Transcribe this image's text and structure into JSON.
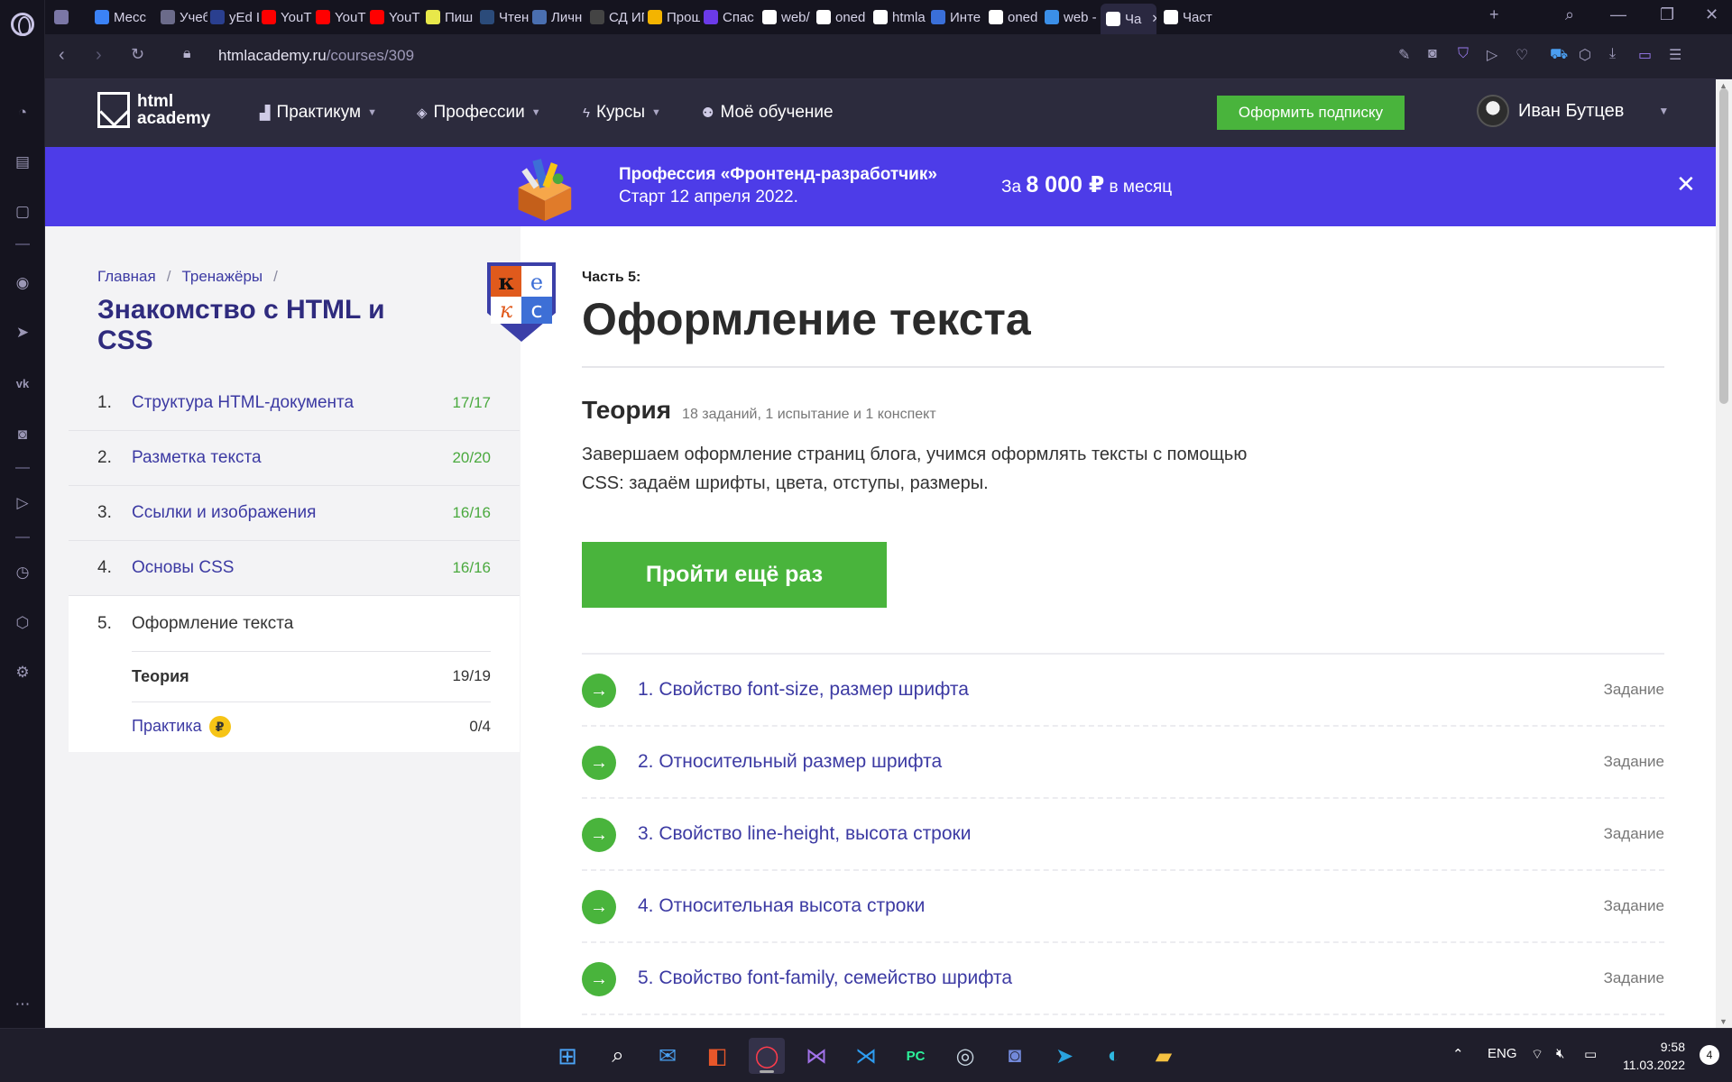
{
  "browser": {
    "tabs": [
      {
        "label": "",
        "favicon_color": "#7b77a6",
        "icon": "gamepad-icon"
      },
      {
        "label": "Месс",
        "favicon_color": "#3b82f6",
        "icon": "messenger-icon"
      },
      {
        "label": "Учеб",
        "favicon_color": "#6b6b8a",
        "icon": "mail-icon"
      },
      {
        "label": "yEd L",
        "favicon_color": "#2a3f8f",
        "icon": "yed-icon"
      },
      {
        "label": "YouT",
        "favicon_color": "#ff0000",
        "icon": "youtube-icon"
      },
      {
        "label": "YouT",
        "favicon_color": "#ff0000",
        "icon": "youtube-icon"
      },
      {
        "label": "YouT",
        "favicon_color": "#ff0000",
        "icon": "youtube-icon"
      },
      {
        "label": "Пиш",
        "favicon_color": "#e8e84a",
        "icon": "info-icon"
      },
      {
        "label": "Чтен",
        "favicon_color": "#2b4b7a",
        "icon": "r-icon"
      },
      {
        "label": "Личн",
        "favicon_color": "#4a6fb0",
        "icon": "doc-icon"
      },
      {
        "label": "СД ИПР",
        "favicon_color": "#444",
        "icon": "sd-icon"
      },
      {
        "label": "Прош",
        "favicon_color": "#f4b400",
        "icon": "drive-icon"
      },
      {
        "label": "Спас",
        "favicon_color": "#6b3ae8",
        "icon": "s-icon"
      },
      {
        "label": "web/",
        "favicon_color": "#ffffff",
        "icon": "github-icon"
      },
      {
        "label": "oned",
        "favicon_color": "#ffffff",
        "icon": "globe-icon"
      },
      {
        "label": "htmla",
        "favicon_color": "#ffffff",
        "icon": "htmlacademy-icon"
      },
      {
        "label": "Инте",
        "favicon_color": "#3a6fd8",
        "icon": "n-icon"
      },
      {
        "label": "oned",
        "favicon_color": "#ffffff",
        "icon": "globe-icon"
      },
      {
        "label": "web -",
        "favicon_color": "#3b8fe8",
        "icon": "onedrive-icon"
      },
      {
        "label": "Ча",
        "favicon_color": "#ffffff",
        "icon": "htmlacademy-icon"
      },
      {
        "label": "Част",
        "favicon_color": "#ffffff",
        "icon": "htmlacademy-icon"
      }
    ],
    "url_host": "htmlacademy.ru",
    "url_path": "/courses/309"
  },
  "header": {
    "logo_line1": "html",
    "logo_line2": "academy",
    "menu": [
      {
        "label": "Практикум",
        "icon": "bar-chart-icon"
      },
      {
        "label": "Профессии",
        "icon": "graduation-cap-icon"
      },
      {
        "label": "Курсы",
        "icon": "lightning-icon"
      },
      {
        "label": "Моё обучение",
        "icon": "people-icon"
      }
    ],
    "subscribe_label": "Оформить подписку",
    "user_name": "Иван Бутцев"
  },
  "promo": {
    "title": "Профессия «Фронтенд-разработчик»",
    "date": "Старт 12 апреля 2022.",
    "price_prefix": "За",
    "price": "8 000 ₽",
    "price_suffix": "в месяц",
    "close": "✕"
  },
  "sidebar": {
    "breadcrumb": [
      "Главная",
      "Тренажёры"
    ],
    "course_title": "Знакомство с HTML и CSS",
    "badge_letters": [
      "к",
      "е",
      "к",
      "с"
    ],
    "chapters": [
      {
        "num": "1.",
        "name": "Структура HTML-документа",
        "score": "17/17"
      },
      {
        "num": "2.",
        "name": "Разметка текста",
        "score": "20/20"
      },
      {
        "num": "3.",
        "name": "Ссылки и изображения",
        "score": "16/16"
      },
      {
        "num": "4.",
        "name": "Основы CSS",
        "score": "16/16"
      },
      {
        "num": "5.",
        "name": "Оформление текста",
        "score": ""
      }
    ],
    "subitems": [
      {
        "name": "Теория",
        "score": "19/19"
      },
      {
        "name": "Практика",
        "score": "0/4",
        "coin": "₽"
      }
    ]
  },
  "main": {
    "part_label": "Часть 5:",
    "part_title": "Оформление текста",
    "theory_title": "Теория",
    "theory_meta": "18 заданий, 1 испытание и 1 конспект",
    "description": "Завершаем оформление страниц блога, учимся оформлять тексты с помощью CSS: задаём шрифты, цвета, отступы, размеры.",
    "retry_label": "Пройти ещё раз",
    "tasks": [
      {
        "name": "1. Свойство font-size, размер шрифта",
        "kind": "Задание"
      },
      {
        "name": "2. Относительный размер шрифта",
        "kind": "Задание"
      },
      {
        "name": "3. Свойство line-height, высота строки",
        "kind": "Задание"
      },
      {
        "name": "4. Относительная высота строки",
        "kind": "Задание"
      },
      {
        "name": "5. Свойство font-family, семейство шрифта",
        "kind": "Задание"
      }
    ]
  },
  "taskbar": {
    "language": "ENG",
    "time": "9:58",
    "date": "11.03.2022",
    "notifications": "4"
  }
}
